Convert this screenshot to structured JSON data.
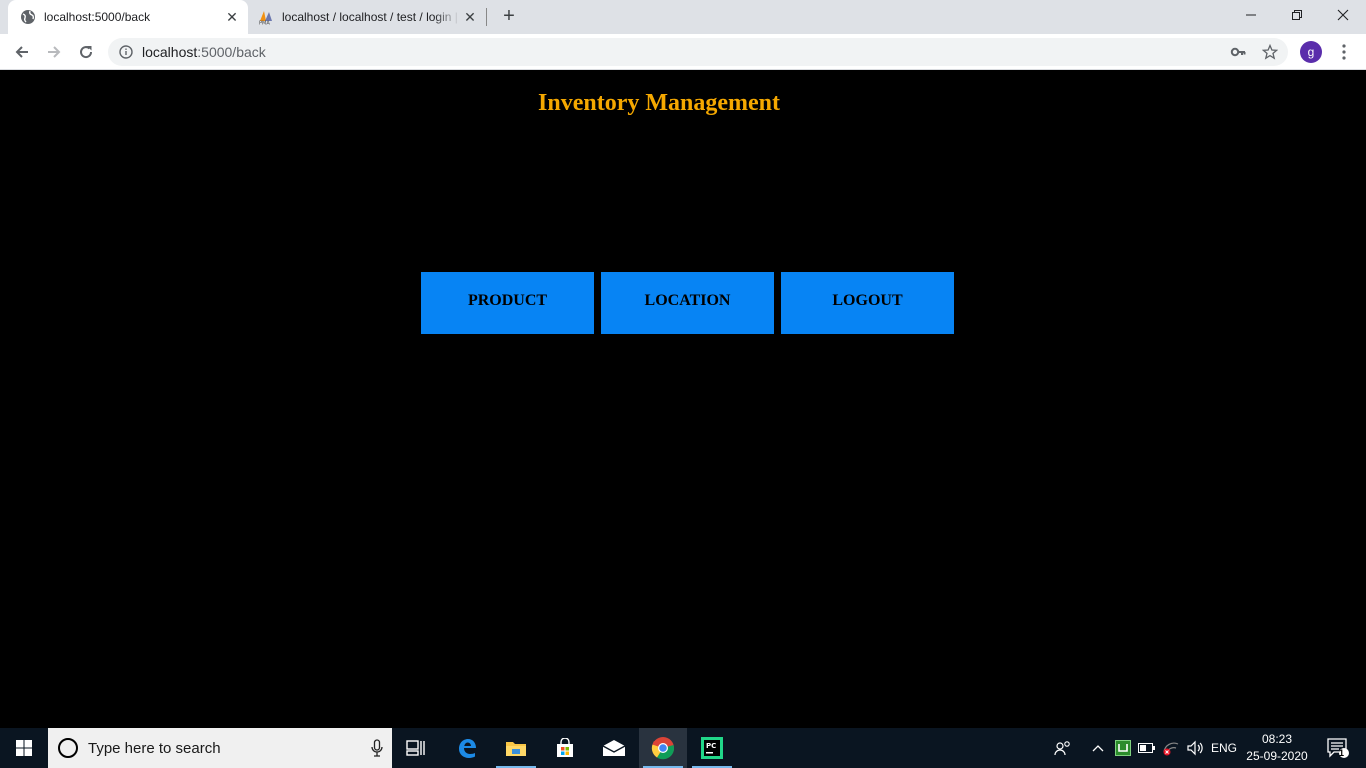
{
  "browser": {
    "tabs": [
      {
        "title": "localhost:5000/back",
        "active": true,
        "favicon": "globe-icon"
      },
      {
        "title": "localhost / localhost / test / login | php",
        "active": false,
        "favicon": "phpmyadmin-icon"
      }
    ],
    "address": {
      "host": "localhost",
      "path": ":5000/back"
    },
    "profile_initial": "g"
  },
  "page": {
    "title": "Inventory Management",
    "title_color": "#f5a800",
    "background": "#000000",
    "button_color": "#0784f4",
    "buttons": [
      {
        "label": "PRODUCT"
      },
      {
        "label": "LOCATION"
      },
      {
        "label": "LOGOUT"
      }
    ]
  },
  "taskbar": {
    "search_placeholder": "Type here to search",
    "language": "ENG",
    "time": "08:23",
    "date": "25-09-2020",
    "notification_count": "1",
    "pinned": [
      "task-view-icon",
      "edge-icon",
      "file-explorer-icon",
      "store-icon",
      "mail-icon",
      "chrome-icon",
      "pycharm-icon"
    ]
  }
}
